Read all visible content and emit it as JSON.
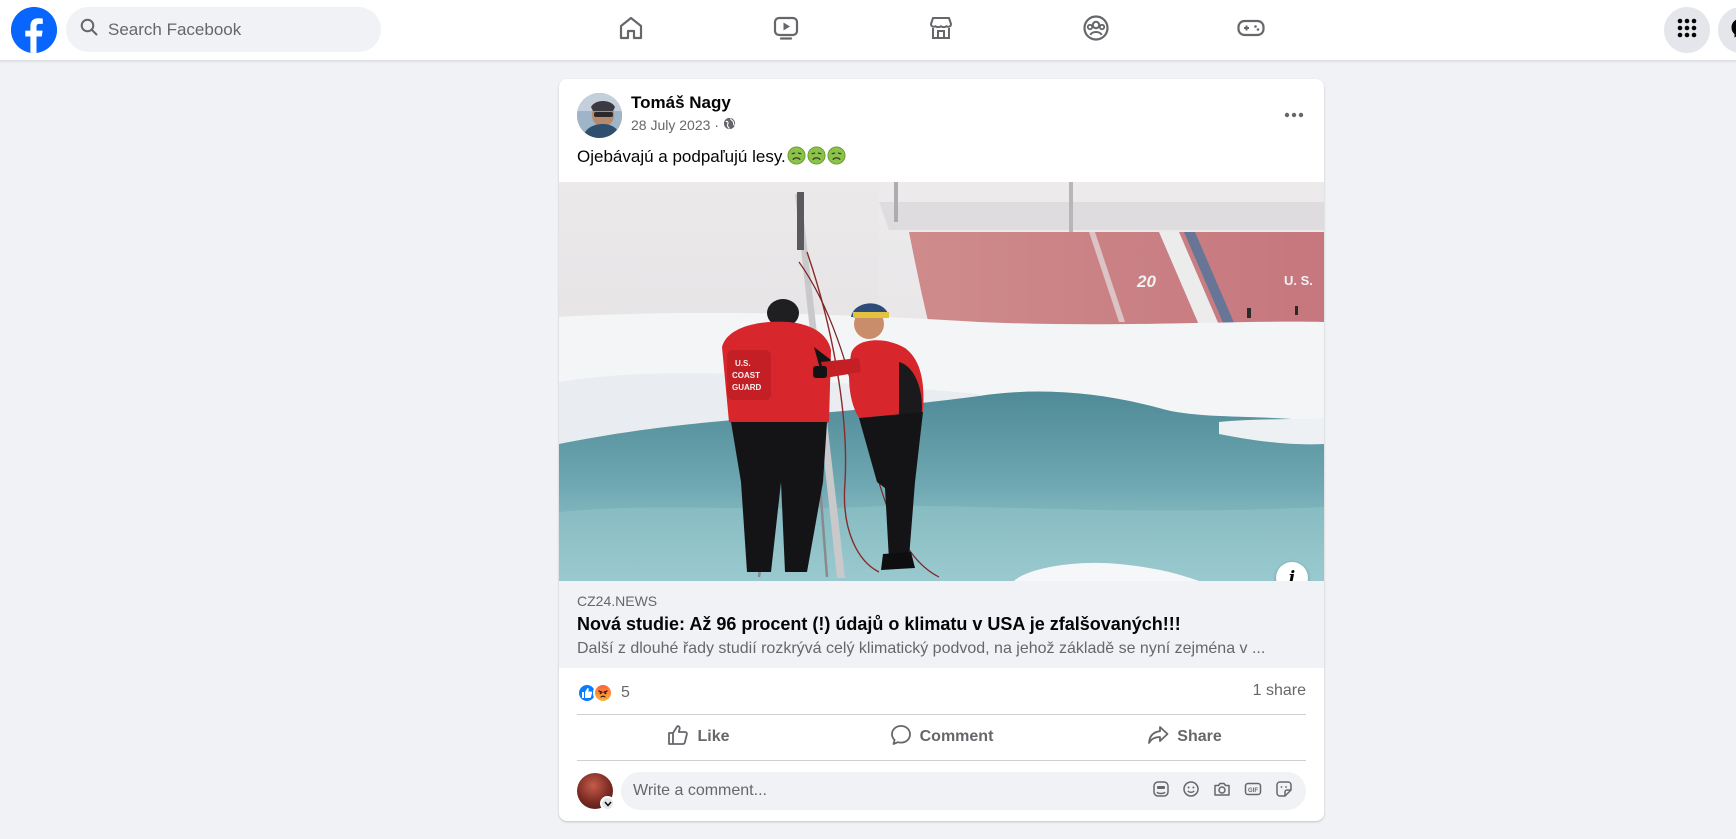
{
  "topbar": {
    "search_placeholder": "Search Facebook",
    "nav": [
      "home-icon",
      "watch-icon",
      "marketplace-icon",
      "groups-icon",
      "gaming-icon"
    ]
  },
  "post": {
    "author": "Tomáš Nagy",
    "date": "28 July 2023",
    "separator": "·",
    "audience_icon": "globe-icon",
    "text": "Ojebávajú a podpaľujú lesy.",
    "emoji": [
      "nauseated-face",
      "nauseated-face",
      "nauseated-face"
    ],
    "link": {
      "domain": "CZ24.NEWS",
      "title": "Nová studie: Až 96 procent (!) údajů o klimatu v USA je zfalšovaných!!!",
      "description": "Další z dlouhé řady studií rozkrývá celý klimatický podvod, na jehož základě se nyní zejména v ..."
    },
    "info_label": "i",
    "reactions": {
      "types": [
        "like",
        "angry"
      ],
      "count": "5"
    },
    "shares": "1 share",
    "actions": {
      "like": "Like",
      "comment": "Comment",
      "share": "Share"
    },
    "comment_placeholder": "Write a comment..."
  },
  "colors": {
    "brand": "#0866ff",
    "background": "#f0f2f5",
    "secondary_text": "#65676b"
  }
}
